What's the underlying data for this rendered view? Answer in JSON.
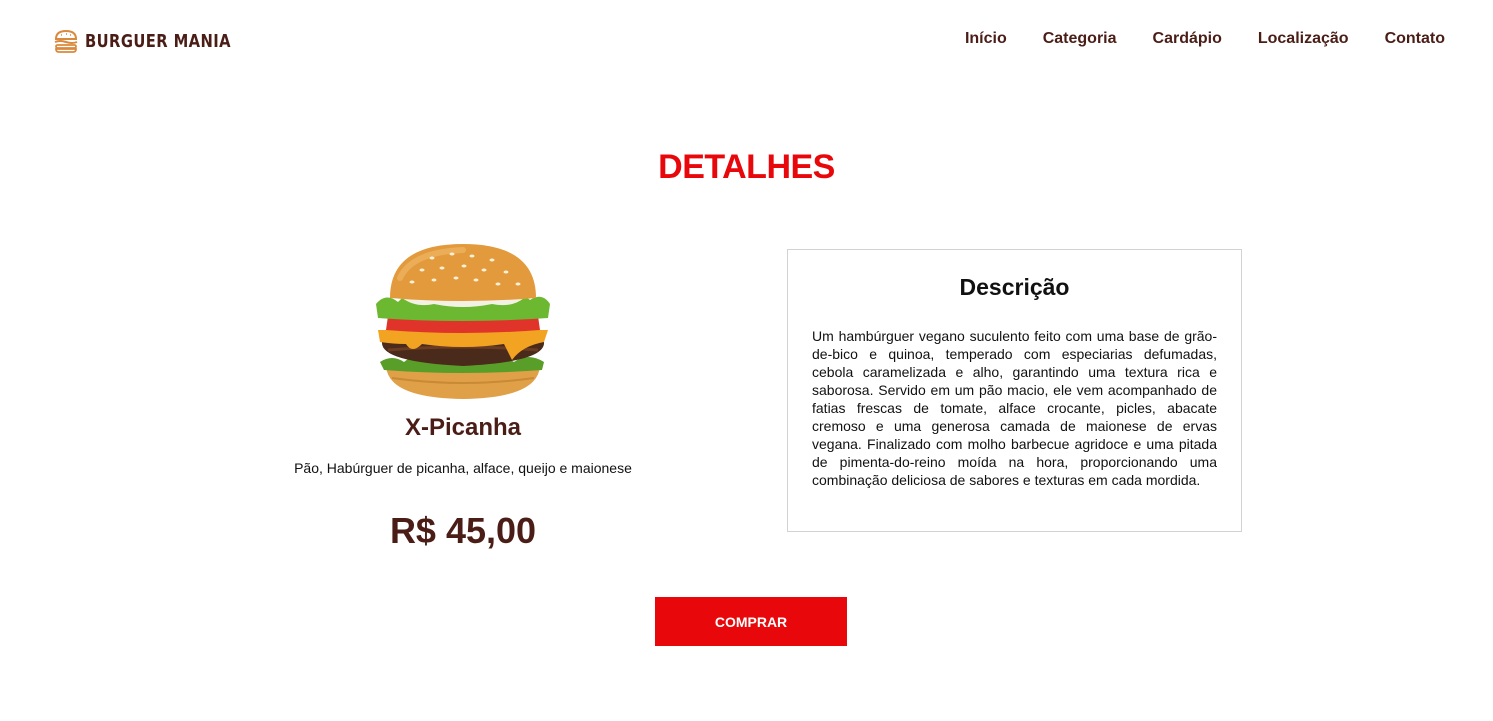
{
  "header": {
    "logo_text": "BURGUER MANIA",
    "logo_icon": "burger-icon",
    "nav": [
      {
        "label": "Início"
      },
      {
        "label": "Categoria"
      },
      {
        "label": "Cardápio"
      },
      {
        "label": "Localização"
      },
      {
        "label": "Contato"
      }
    ]
  },
  "page_title": "DETALHES",
  "product": {
    "image": "burger-photo",
    "name": "X-Picanha",
    "ingredients": "Pão, Habúrguer de picanha, alface, queijo e maionese",
    "price": "R$ 45,00"
  },
  "description": {
    "title": "Descrição",
    "text": "Um hambúrguer vegano suculento feito com uma base de grão-de-bico e quinoa, temperado com especiarias defumadas, cebola caramelizada e alho, garantindo uma textura rica e saborosa. Servido em um pão macio, ele vem acompanhado de fatias frescas de tomate, alface crocante, picles, abacate cremoso e uma generosa camada de maionese de ervas vegana. Finalizado com molho barbecue agridoce e uma pitada de pimenta-do-reino moída na hora, proporcionando uma combinação deliciosa de sabores e texturas em cada mordida."
  },
  "buy_button": "COMPRAR",
  "colors": {
    "brand_brown": "#4a1d17",
    "accent_red": "#e8080b",
    "logo_orange": "#d98a3d"
  }
}
